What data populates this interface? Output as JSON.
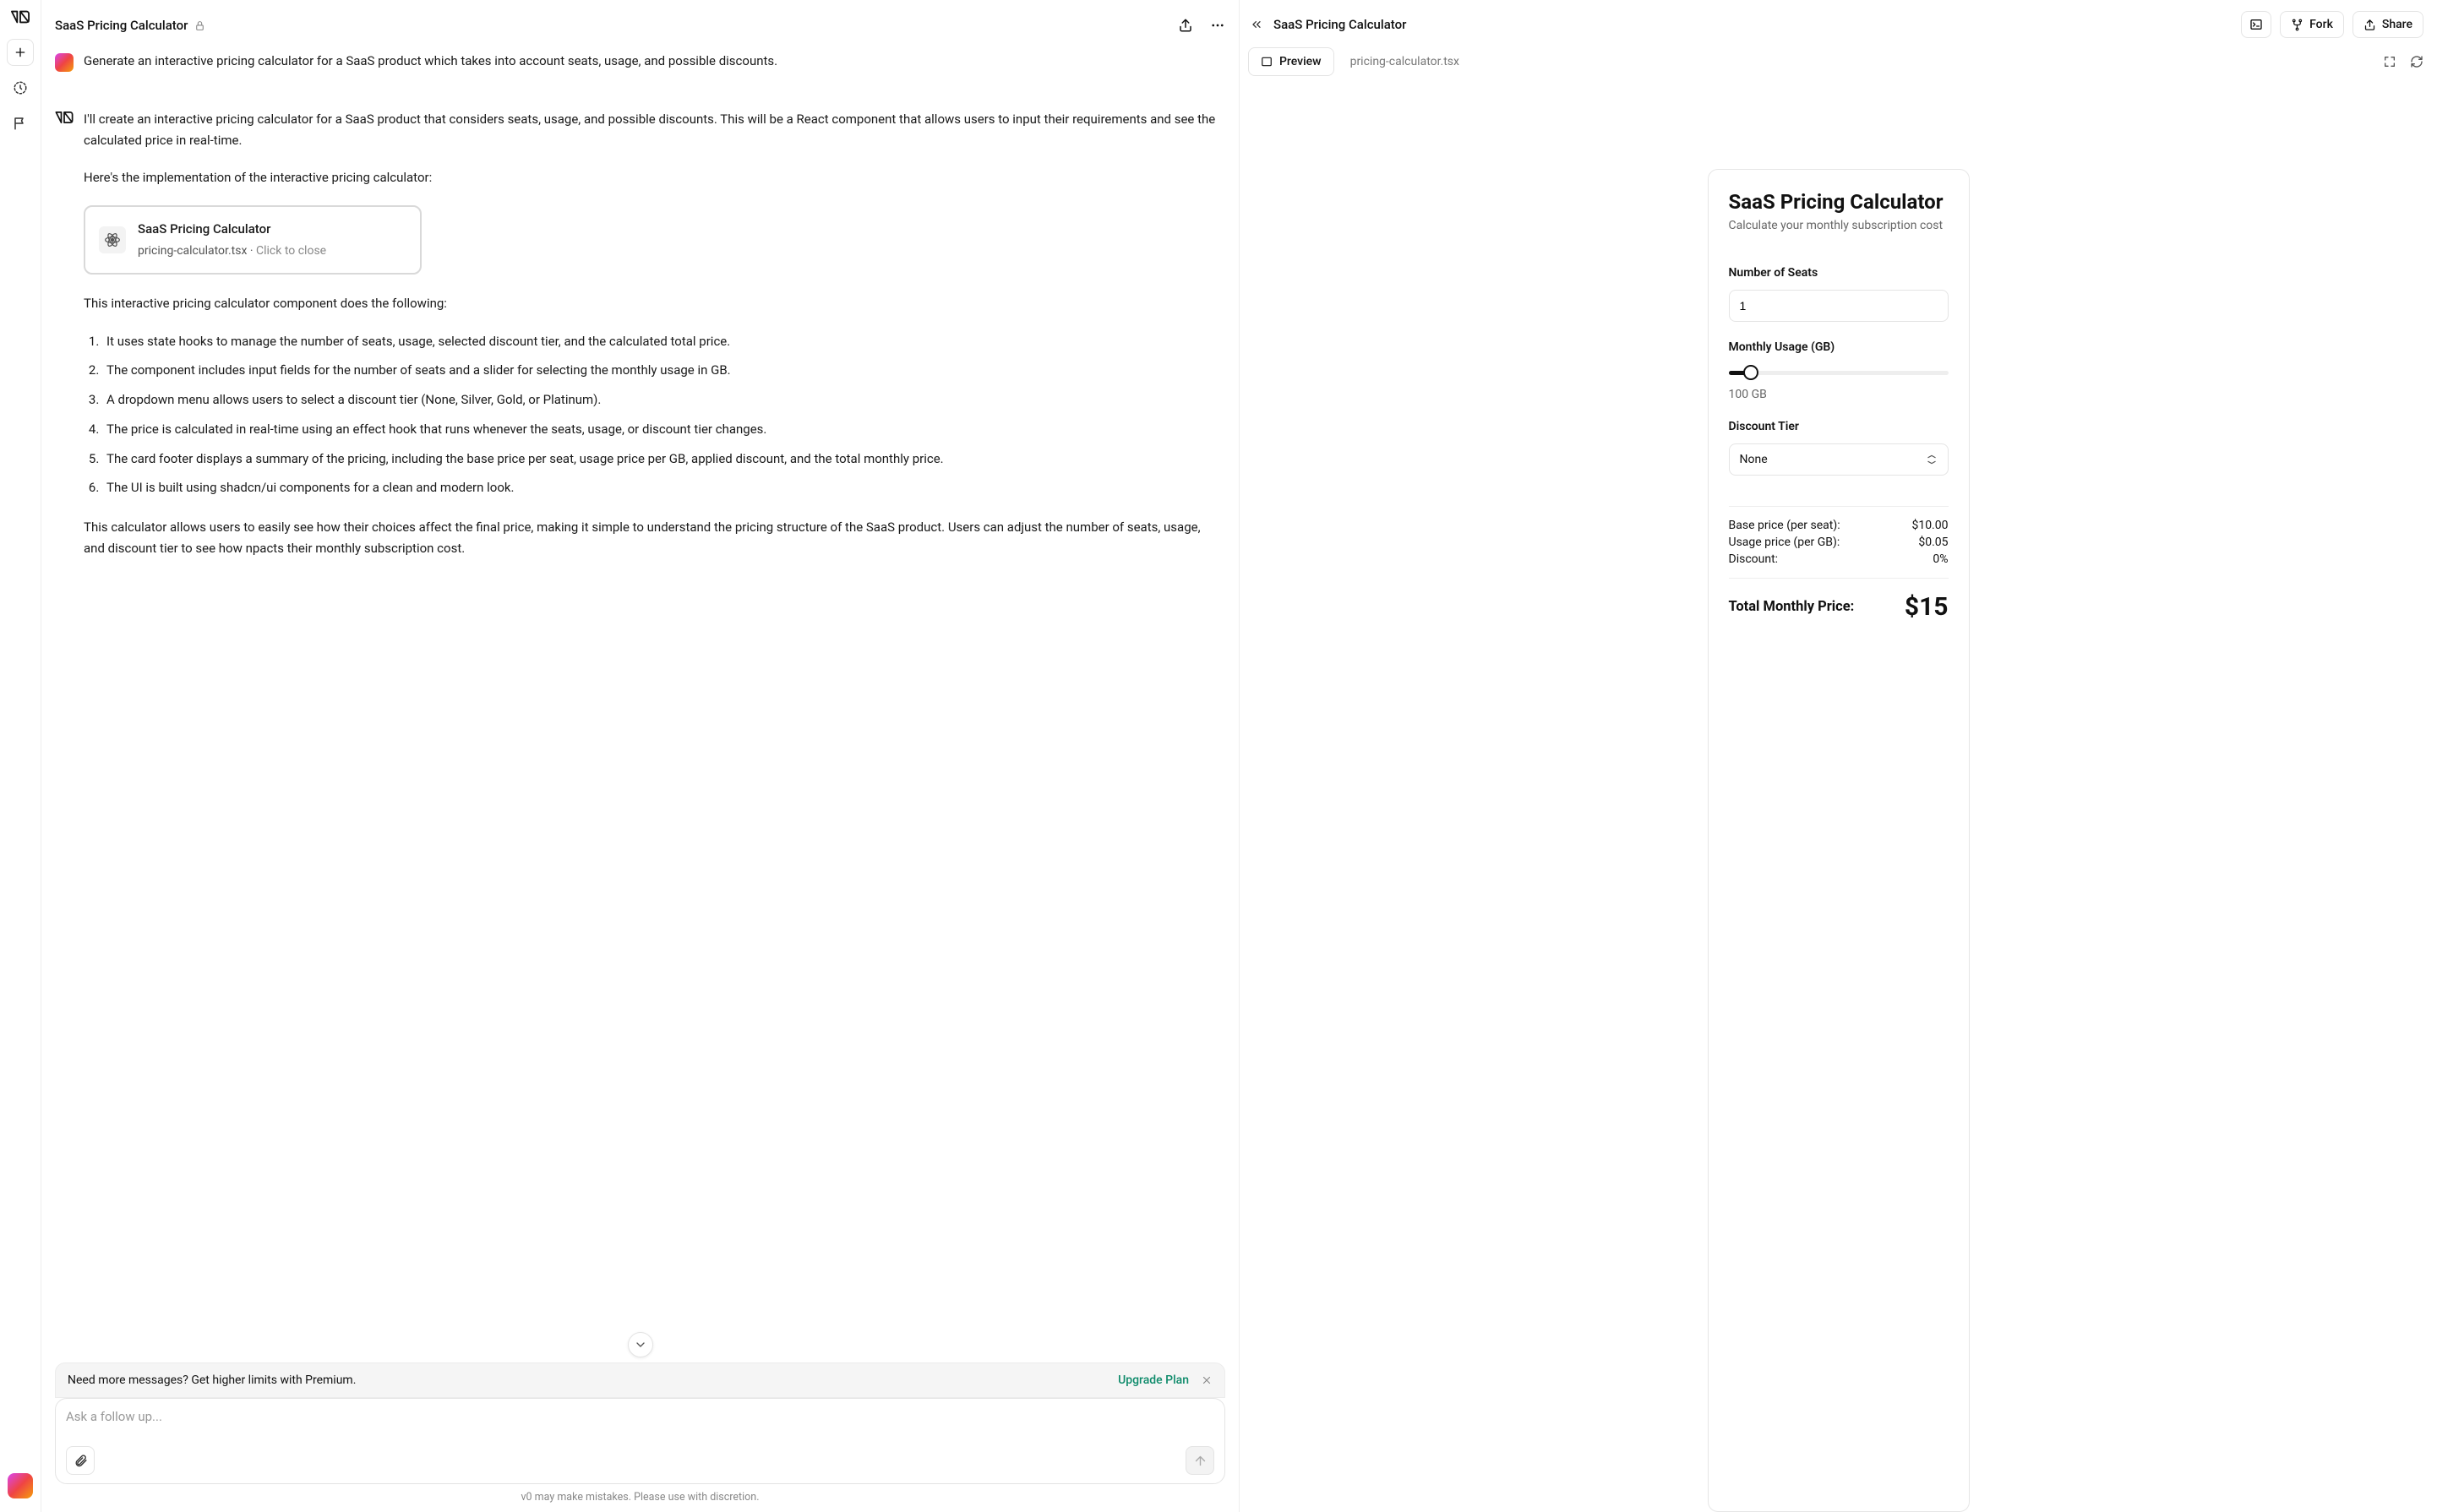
{
  "chat": {
    "title": "SaaS Pricing Calculator",
    "header_actions": {
      "share_icon": "share",
      "more_icon": "more"
    },
    "messages": {
      "user_prompt": "Generate an interactive pricing calculator for a SaaS product which takes into account seats, usage, and possible discounts.",
      "assistant_intro": "I'll create an interactive pricing calculator for a SaaS product that considers seats, usage, and possible discounts. This will be a React component that allows users to input their requirements and see the calculated price in real-time.",
      "assistant_lead": "Here's the implementation of the interactive pricing calculator:",
      "code_card": {
        "title": "SaaS Pricing Calculator",
        "file": "pricing-calculator.tsx",
        "hint": "Click to close"
      },
      "assistant_post": "This interactive pricing calculator component does the following:",
      "bullets": [
        "It uses state hooks to manage the number of seats, usage, selected discount tier, and the calculated total price.",
        "The component includes input fields for the number of seats and a slider for selecting the monthly usage in GB.",
        "A dropdown menu allows users to select a discount tier (None, Silver, Gold, or Platinum).",
        "The price is calculated in real-time using an effect hook that runs whenever the seats, usage, or discount tier changes.",
        "The card footer displays a summary of the pricing, including the base price per seat, usage price per GB, applied discount, and the total monthly price.",
        "The UI is built using shadcn/ui components for a clean and modern look."
      ],
      "assistant_outro": "This calculator allows users to easily see how their choices affect the final price, making it simple to understand the pricing structure of the SaaS product. Users can adjust the number of seats, usage, and discount tier to see how     npacts their monthly subscription cost."
    },
    "banner": {
      "text": "Need more messages? Get higher limits with Premium.",
      "link": "Upgrade Plan"
    },
    "composer": {
      "placeholder": "Ask a follow up..."
    },
    "disclaimer": "v0 may make mistakes. Please use with discretion."
  },
  "preview": {
    "title": "SaaS Pricing Calculator",
    "buttons": {
      "console": "console",
      "fork": "Fork",
      "share": "Share"
    },
    "tabs": {
      "preview": "Preview",
      "file": "pricing-calculator.tsx"
    },
    "calculator": {
      "heading": "SaaS Pricing Calculator",
      "subtitle": "Calculate your monthly subscription cost",
      "seats_label": "Number of Seats",
      "seats_value": "1",
      "usage_label": "Monthly Usage (GB)",
      "usage_value": "100 GB",
      "discount_label": "Discount Tier",
      "discount_value": "None",
      "summary": {
        "base_label": "Base price (per seat):",
        "base_value": "$10.00",
        "usage_label": "Usage price (per GB):",
        "usage_value": "$0.05",
        "discount_label": "Discount:",
        "discount_value": "0%"
      },
      "total_label": "Total Monthly Price:",
      "total_value": "$15"
    }
  }
}
